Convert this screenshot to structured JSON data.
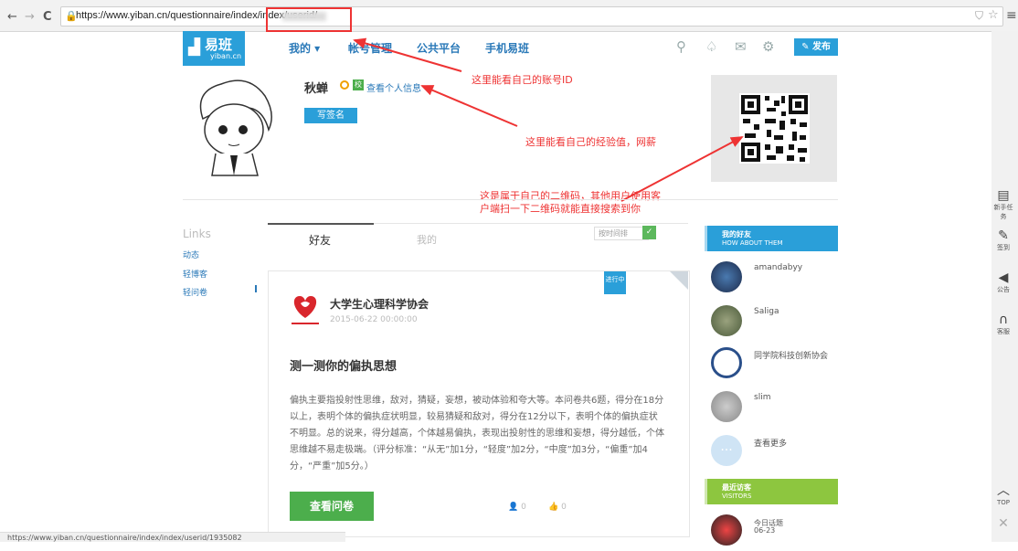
{
  "browser": {
    "back_icon": "←",
    "forward_icon": "→",
    "reload_icon": "C",
    "url": "https://www.yiban.cn/questionnaire/index/index/userid/",
    "status_url": "https://www.yiban.cn/questionnaire/index/index/userid/1935082"
  },
  "header": {
    "logo_text": "易班",
    "logo_sub": "yiban.cn",
    "menu": [
      "我的 ▾",
      "帐号管理",
      "公共平台",
      "手机易班"
    ],
    "publish_label": "发布"
  },
  "profile": {
    "name": "秋蝉",
    "view_info": "查看个人信息",
    "sign_label": "写签名"
  },
  "annotations": {
    "account_id": "这里能看自己的账号ID",
    "experience": "这里能看自己的经验值，网薪",
    "qr": "这是属于自己的二维码，其他用户使用客户端扫一下二维码就能直接搜索到你"
  },
  "left_nav": {
    "title": "Links",
    "items": [
      "动态",
      "轻博客",
      "轻问卷"
    ]
  },
  "tabs": [
    "好友",
    "我的"
  ],
  "sort_label": "按时间排",
  "card": {
    "badge": "进行中",
    "org_name": "大学生心理科学协会",
    "date": "2015-06-22 00:00:00",
    "title": "测一测你的偏执思想",
    "description": "偏执主要指投射性思维，敌对，猜疑，妄想，被动体验和夸大等。本问卷共6题，得分在18分以上，表明个体的偏执症状明显，较易猜疑和敌对，得分在12分以下，表明个体的偏执症状不明显。总的说来，得分越高，个体越易偏执，表现出投射性的思维和妄想，得分越低，个体思维越不易走极端。（评分标准：“从无”加1分，“轻度”加2分，“中度”加3分，“偏重”加4分，“严重”加5分。）",
    "view_button": "查看问卷",
    "participants": "0",
    "likes": "0"
  },
  "friends": {
    "title": "我的好友",
    "subtitle": "HOW ABOUT THEM",
    "items": [
      {
        "name": "amandabyy",
        "color": "#2c3e6b"
      },
      {
        "name": "Saliga",
        "color": "#6b7a55"
      },
      {
        "name": "同学院科技创新协会",
        "color": "#2a4f8a"
      },
      {
        "name": "slim",
        "color": "#9a9a9a"
      }
    ],
    "more": "查看更多"
  },
  "visitors": {
    "title": "最近访客",
    "subtitle": "VISITORS",
    "item_name": "今日话题",
    "item_date": "06-23"
  },
  "right_sidebar": [
    {
      "icon": "task-icon",
      "glyph": "▤",
      "label": "新手任务"
    },
    {
      "icon": "checkin-icon",
      "glyph": "✎",
      "label": "签到"
    },
    {
      "icon": "announce-icon",
      "glyph": "◀",
      "label": "公告"
    },
    {
      "icon": "headset-icon",
      "glyph": "∩",
      "label": "客服"
    },
    {
      "icon": "top-icon",
      "glyph": "︿",
      "label": "TOP"
    },
    {
      "icon": "close-icon",
      "glyph": "✕",
      "label": ""
    }
  ],
  "colors": {
    "accent": "#2a9fd9",
    "green": "#4cae4c",
    "annotation": "#e33333",
    "visitors": "#8dc63f"
  }
}
